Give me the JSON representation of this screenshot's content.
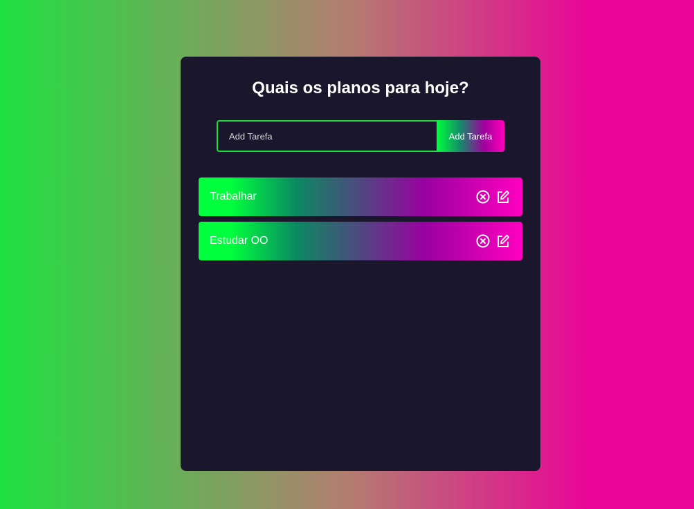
{
  "app": {
    "title": "Quais os planos para hoje?"
  },
  "form": {
    "input_placeholder": "Add Tarefa",
    "input_value": "",
    "button_label": "Add Tarefa"
  },
  "todos": [
    {
      "text": "Trabalhar",
      "icons": [
        "close-circle-icon",
        "edit-icon"
      ]
    },
    {
      "text": "Estudar OO",
      "icons": [
        "close-circle-icon",
        "edit-icon"
      ]
    }
  ],
  "colors": {
    "panel": "#1a172c",
    "input_border": "#1fe03a",
    "gradient_start": "#00ff3c",
    "gradient_end": "#ff00c0"
  }
}
